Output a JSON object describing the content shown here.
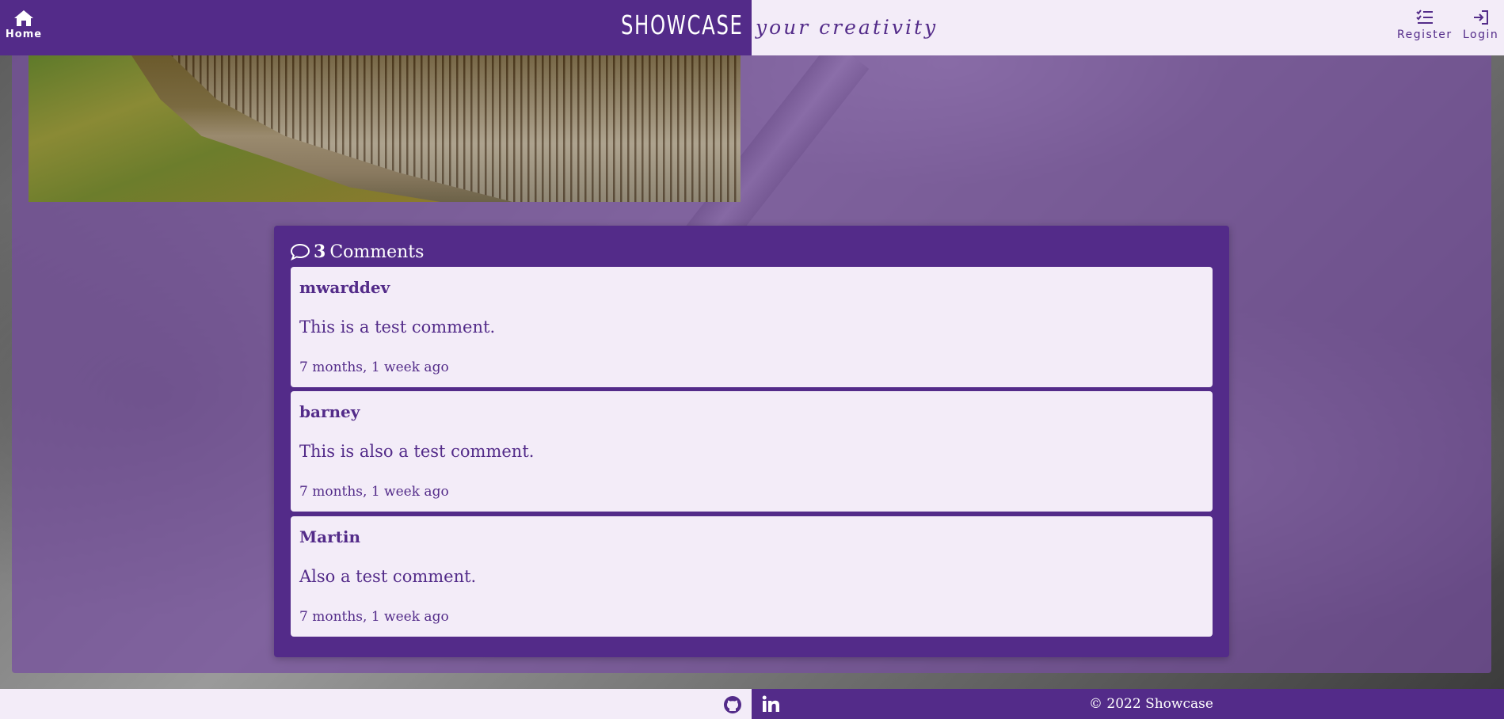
{
  "header": {
    "home_label": "Home",
    "brand": "SHOWCASE",
    "tagline": "your creativity",
    "register_label": "Register",
    "login_label": "Login"
  },
  "post": {
    "image_description": "lakeside-grass-reeds"
  },
  "comments": {
    "count": "3",
    "label": "Comments",
    "items": [
      {
        "author": "mwarddev",
        "body": "This is a test comment.",
        "time": "7 months, 1 week ago"
      },
      {
        "author": "barney",
        "body": "This is also a test comment.",
        "time": "7 months, 1 week ago"
      },
      {
        "author": "Martin",
        "body": "Also a test comment.",
        "time": "7 months, 1 week ago"
      }
    ]
  },
  "footer": {
    "copyright": "© 2022 Showcase",
    "icons": [
      "github-icon",
      "linkedin-icon"
    ]
  },
  "colors": {
    "brand_purple": "#532b89",
    "light_lavender": "#f3ecf8",
    "white": "#ffffff"
  }
}
